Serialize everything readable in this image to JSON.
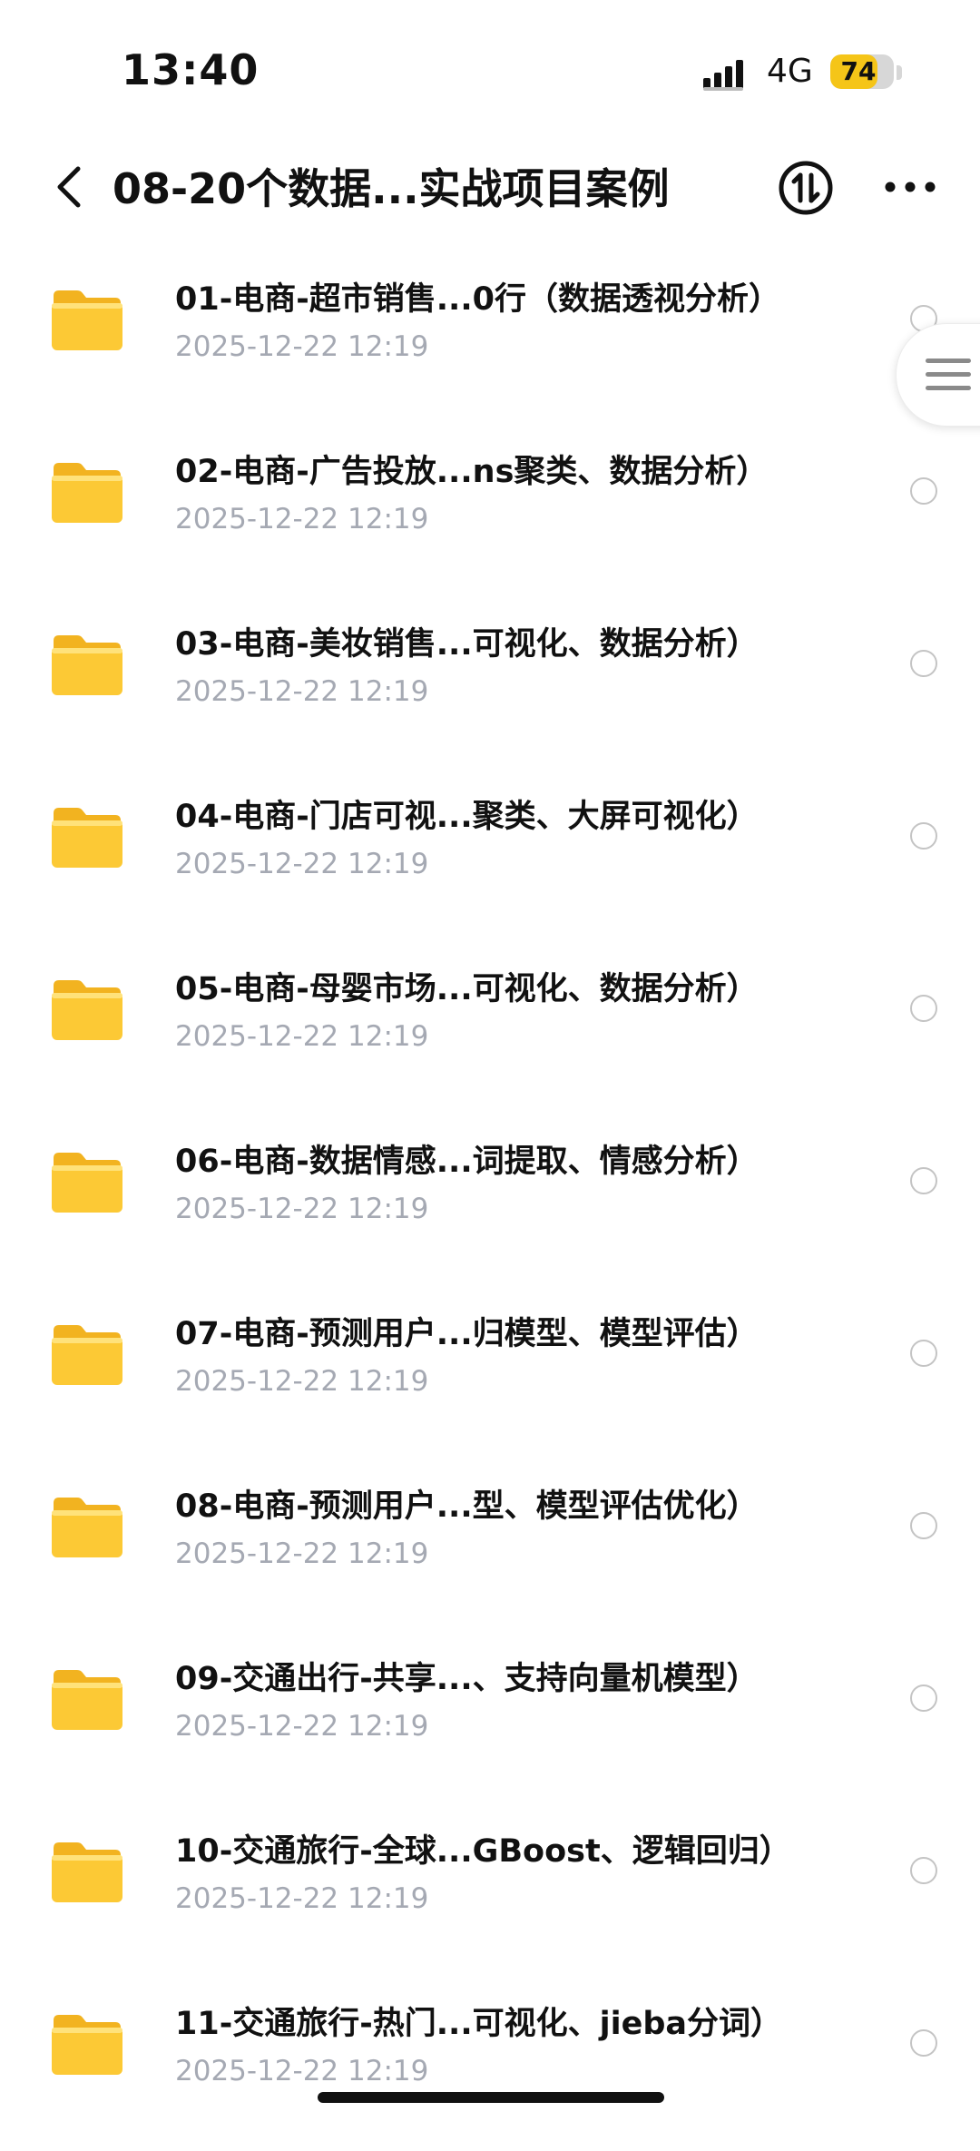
{
  "status_bar": {
    "time": "13:40",
    "network": "4G",
    "battery": "74",
    "battery_level": 0.74,
    "battery_color": "#f5c518"
  },
  "header": {
    "back_icon": "chevron-left-icon",
    "title": "08-20个数据...实战项目案例",
    "sort_icon": "sort-arrows-icon",
    "more_icon": "ellipsis-icon"
  },
  "side_handle": {
    "icon": "menu-lines-icon"
  },
  "files": [
    {
      "name": "01-电商-超市销售...0行（数据透视分析）",
      "date": "2025-12-22 12:19"
    },
    {
      "name": "02-电商-广告投放...ns聚类、数据分析）",
      "date": "2025-12-22 12:19"
    },
    {
      "name": "03-电商-美妆销售...可视化、数据分析）",
      "date": "2025-12-22 12:19"
    },
    {
      "name": "04-电商-门店可视...聚类、大屏可视化）",
      "date": "2025-12-22 12:19"
    },
    {
      "name": "05-电商-母婴市场...可视化、数据分析）",
      "date": "2025-12-22 12:19"
    },
    {
      "name": "06-电商-数据情感...词提取、情感分析）",
      "date": "2025-12-22 12:19"
    },
    {
      "name": "07-电商-预测用户...归模型、模型评估）",
      "date": "2025-12-22 12:19"
    },
    {
      "name": "08-电商-预测用户...型、模型评估优化）",
      "date": "2025-12-22 12:19"
    },
    {
      "name": "09-交通出行-共享...、支持向量机模型）",
      "date": "2025-12-22 12:19"
    },
    {
      "name": "10-交通旅行-全球...GBoost、逻辑回归）",
      "date": "2025-12-22 12:19"
    },
    {
      "name": "11-交通旅行-热门...可视化、jieba分词）",
      "date": "2025-12-22 12:19"
    }
  ],
  "colors": {
    "folder": "#fcc935",
    "date_text": "#a5a9b3",
    "radio_border": "#c4c4c4"
  }
}
